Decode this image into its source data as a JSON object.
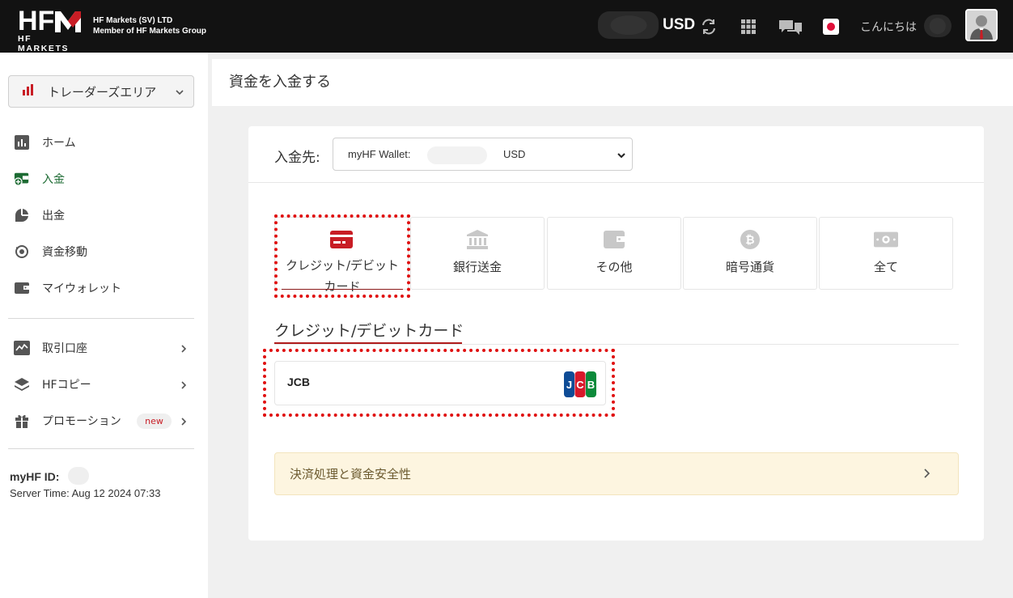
{
  "header": {
    "logo_main": "HF",
    "logo_sub": "HF MARKETS",
    "company_line1": "HF Markets (SV) LTD",
    "company_line2": "Member of HF Markets Group",
    "currency": "USD",
    "greeting": "こんにちは"
  },
  "sidebar": {
    "area_label": "トレーダーズエリア",
    "items": [
      {
        "label": "ホーム",
        "icon": "chart-bars-icon"
      },
      {
        "label": "入金",
        "icon": "wallet-plus-icon"
      },
      {
        "label": "出金",
        "icon": "wallet-out-icon"
      },
      {
        "label": "資金移動",
        "icon": "transfer-icon"
      },
      {
        "label": "マイウォレット",
        "icon": "wallet-icon"
      },
      {
        "label": "取引口座",
        "icon": "trading-chart-icon"
      },
      {
        "label": "HFコピー",
        "icon": "layers-icon"
      },
      {
        "label": "プロモーション",
        "icon": "gift-icon",
        "badge": "new"
      }
    ],
    "myhf_id_label": "myHF ID:",
    "server_time": "Server Time: Aug 12 2024 07:33"
  },
  "main": {
    "page_title": "資金を入金する",
    "destination_label": "入金先:",
    "wallet_label": "myHF Wallet:",
    "wallet_currency": "USD",
    "methods": [
      {
        "label": "クレジット/デビットカード",
        "icon": "credit-card-icon",
        "active": true
      },
      {
        "label": "銀行送金",
        "icon": "bank-icon"
      },
      {
        "label": "その他",
        "icon": "wallet-icon"
      },
      {
        "label": "暗号通貨",
        "icon": "bitcoin-icon"
      },
      {
        "label": "全て",
        "icon": "cash-icon"
      }
    ],
    "section_title": "クレジット/デビットカード",
    "card_option": "JCB",
    "safety_text": "決済処理と資金安全性"
  },
  "colors": {
    "brand_red": "#c81d25",
    "active_green": "#1d6b33",
    "header_bg": "#121212",
    "highlight_dots": "#e01010"
  }
}
